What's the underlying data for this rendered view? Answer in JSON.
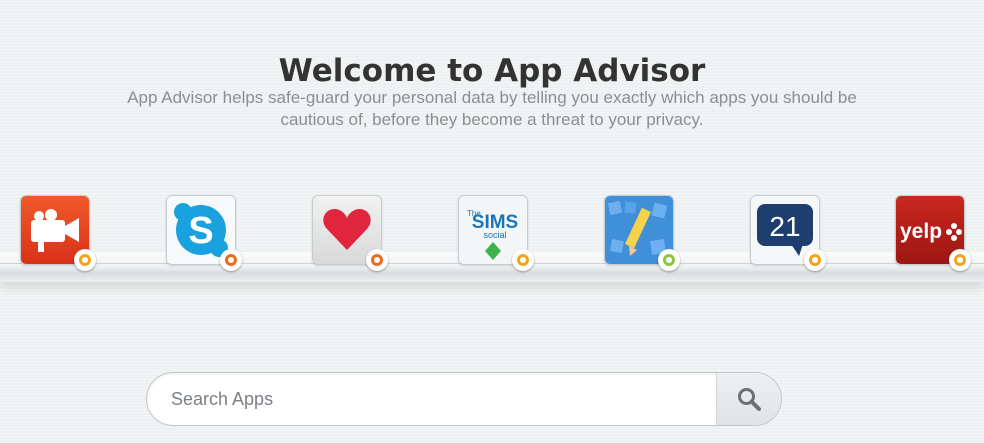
{
  "header": {
    "title": "Welcome to App Advisor",
    "description_line1": "App Advisor helps safe-guard your personal data by telling you exactly which apps you should be",
    "description_line2": "cautious of, before they become a threat to your privacy."
  },
  "apps": [
    {
      "name": "video-camera-app",
      "icon": "video-camera-icon",
      "status_color": "#f2a51c"
    },
    {
      "name": "skype-app",
      "icon": "skype-icon",
      "status_color": "#ef6a1e"
    },
    {
      "name": "heart-app",
      "icon": "heart-icon",
      "status_color": "#ef6a1e"
    },
    {
      "name": "the-sims-social-app",
      "icon": "sims-icon",
      "status_color": "#f2a51c",
      "label_1": "The",
      "label_2": "SIMS",
      "label_3": "social"
    },
    {
      "name": "draw-something-app",
      "icon": "pencil-icon",
      "status_color": "#8cc63f"
    },
    {
      "name": "21-app",
      "icon": "speech-bubble-21-icon",
      "status_color": "#f2a51c",
      "label": "21"
    },
    {
      "name": "yelp-app",
      "icon": "yelp-icon",
      "status_color": "#f2a51c",
      "label": "yelp"
    }
  ],
  "search": {
    "placeholder": "Search Apps",
    "value": "",
    "button_icon": "search-icon"
  }
}
